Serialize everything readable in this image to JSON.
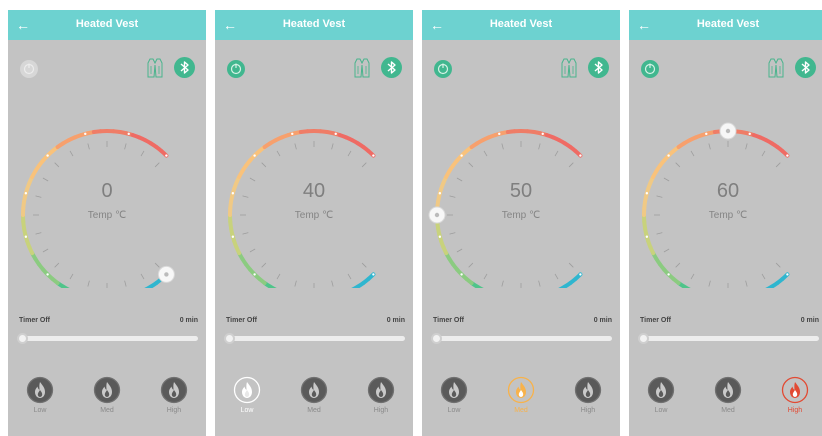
{
  "screens": [
    {
      "title": "Heated Vest",
      "power": false,
      "temp": "0",
      "temp_unit": "Temp ℃",
      "timer_label": "Timer Off",
      "timer_value": "0 min",
      "active_mode": "none",
      "modes": [
        {
          "key": "low",
          "label": "Low"
        },
        {
          "key": "med",
          "label": "Med"
        },
        {
          "key": "high",
          "label": "High"
        }
      ]
    },
    {
      "title": "Heated Vest",
      "power": true,
      "temp": "40",
      "temp_unit": "Temp ℃",
      "timer_label": "Timer Off",
      "timer_value": "0 min",
      "active_mode": "low",
      "modes": [
        {
          "key": "low",
          "label": "Low"
        },
        {
          "key": "med",
          "label": "Med"
        },
        {
          "key": "high",
          "label": "High"
        }
      ]
    },
    {
      "title": "Heated Vest",
      "power": true,
      "temp": "50",
      "temp_unit": "Temp ℃",
      "timer_label": "Timer Off",
      "timer_value": "0 min",
      "active_mode": "med",
      "modes": [
        {
          "key": "low",
          "label": "Low"
        },
        {
          "key": "med",
          "label": "Med"
        },
        {
          "key": "high",
          "label": "High"
        }
      ]
    },
    {
      "title": "Heated Vest",
      "power": true,
      "temp": "60",
      "temp_unit": "Temp ℃",
      "timer_label": "Timer Off",
      "timer_value": "0 min",
      "active_mode": "high",
      "modes": [
        {
          "key": "low",
          "label": "Low"
        },
        {
          "key": "med",
          "label": "Med"
        },
        {
          "key": "high",
          "label": "High"
        }
      ]
    }
  ],
  "colors": {
    "header": "#6dd2d0",
    "power_on": "#41b78f",
    "power_off": "#d7d7d7",
    "flame_inactive": "#555555",
    "flame_low_active": "#ffffff",
    "flame_med_active": "#f8b24a",
    "flame_high_active": "#e24a33"
  },
  "icons": {
    "back": "arrow-left-icon",
    "power": "power-icon",
    "vest": "vest-icon",
    "bluetooth": "bluetooth-icon",
    "flame": "flame-icon"
  }
}
